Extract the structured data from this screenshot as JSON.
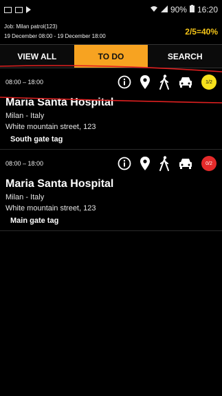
{
  "status": {
    "battery": "90%",
    "time": "16:20"
  },
  "job": {
    "line1": "Job: Milan patrol(123)",
    "line2": "19 December 08:00 - 19 December 18:00",
    "progress": "2/5=40%"
  },
  "tabs": [
    {
      "label": "VIEW ALL",
      "active": false
    },
    {
      "label": "TO DO",
      "active": true
    },
    {
      "label": "SEARCH",
      "active": false
    }
  ],
  "items": [
    {
      "time": "08:00 – 18:00",
      "name": "Maria Santa Hospital",
      "city": "Milan - Italy",
      "address": "White mountain street, 123",
      "tag": "South gate tag",
      "badge": "1/2",
      "badge_color": "#f6e11c"
    },
    {
      "time": "08:00 – 18:00",
      "name": "Maria Santa Hospital",
      "city": "Milan - Italy",
      "address": "White mountain street, 123",
      "tag": "Main gate tag",
      "badge": "0/2",
      "badge_color": "#e52a2a"
    }
  ],
  "icons": [
    "info-icon",
    "location-pin-icon",
    "walking-icon",
    "car-icon"
  ],
  "colors": {
    "active_tab": "#f7a321",
    "progress": "#f5c518",
    "annotation": "#e02020"
  }
}
